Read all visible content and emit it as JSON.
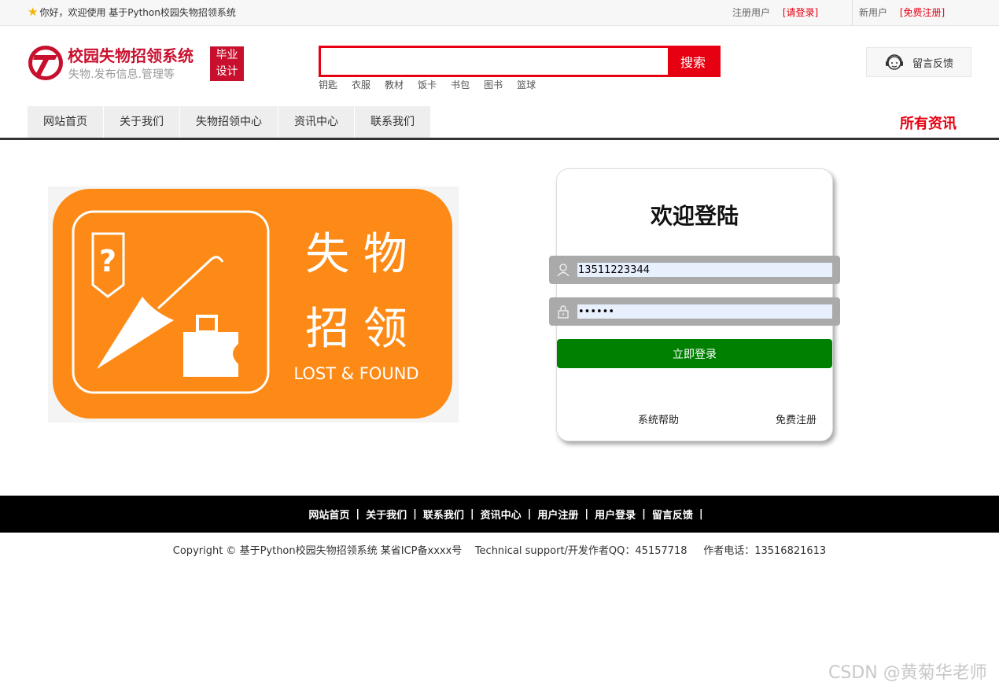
{
  "topbar": {
    "welcome": "你好，欢迎使用 基于Python校园失物招领系统",
    "registered_label": "注册用户",
    "login_link": "[请登录]",
    "new_user_label": "新用户",
    "register_link": "[免费注册]"
  },
  "logo": {
    "title": "校园失物招领系统",
    "subtitle": "失物.发布信息.管理等",
    "badge_line1": "毕业",
    "badge_line2": "设计"
  },
  "search": {
    "button": "搜索",
    "value": "",
    "hotwords": [
      "钥匙",
      "衣服",
      "教材",
      "饭卡",
      "书包",
      "图书",
      "篮球"
    ]
  },
  "feedback": {
    "label": "留言反馈",
    "icon": "customer-service-icon"
  },
  "nav": {
    "items": [
      "网站首页",
      "关于我们",
      "失物招领中心",
      "资讯中心",
      "联系我们"
    ],
    "right": "所有资讯"
  },
  "banner": {
    "line1": "失 物",
    "line2": "招 领",
    "english": "LOST & FOUND",
    "bg_color": "#fd8a16"
  },
  "login": {
    "title": "欢迎登陆",
    "username": "13511223344",
    "password": "••••••",
    "submit": "立即登录",
    "help": "系统帮助",
    "register": "免费注册",
    "button_color": "#008000"
  },
  "footer": {
    "links": [
      "网站首页",
      "关于我们",
      "联系我们",
      "资讯中心",
      "用户注册",
      "用户登录",
      "留言反馈"
    ],
    "copyright": "Copyright © 基于Python校园失物招领系统 某省ICP备xxxx号    Technical support/开发作者QQ：45157718     作者电话：13516821613"
  },
  "watermark": "CSDN @黄菊华老师"
}
